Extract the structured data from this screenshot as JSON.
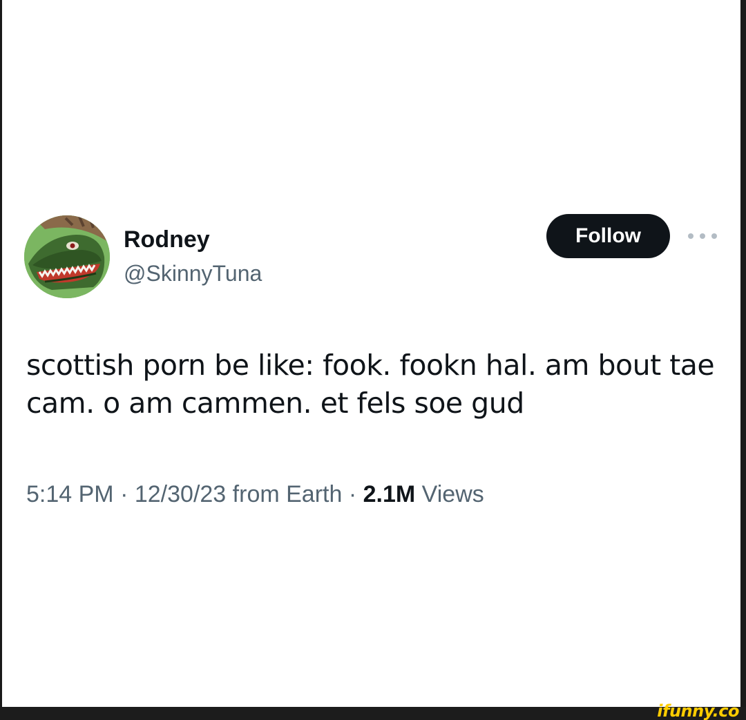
{
  "tweet": {
    "display_name": "Rodney",
    "handle": "@SkinnyTuna",
    "follow_label": "Follow",
    "text": "scottish porn be like: fook. fookn hal. am bout tae cam. o am cammen. et fels soe gud",
    "time": "5:14 PM",
    "date": "12/30/23",
    "source": "from Earth",
    "separator": "·",
    "views_count": "2.1M",
    "views_label": "Views"
  },
  "icons": {
    "avatar": "green-lizard-avatar",
    "more": "more-options-icon"
  },
  "colors": {
    "follow_bg": "#0f1419",
    "secondary_text": "#536471",
    "watermark": "#ffcc00"
  },
  "watermark": {
    "text": "ifunny.co"
  }
}
